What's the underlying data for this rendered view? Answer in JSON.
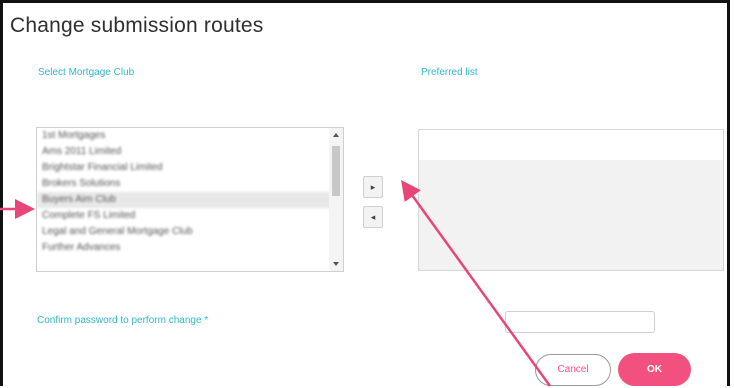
{
  "dialog": {
    "title": "Change submission routes",
    "select_label": "Select Mortgage Club",
    "preferred_label": "Preferred list",
    "confirm_label": "Confirm password to perform change *",
    "cancel_label": "Cancel",
    "ok_label": "OK",
    "move_right_label": "▸",
    "move_left_label": "◂"
  },
  "mortgage_clubs": [
    "1st Mortgages",
    "Ams 2011 Limited",
    "Brightstar Financial Limited",
    "Brokers Solutions",
    "Buyers Aim Club",
    "Complete FS Limited",
    "Legal and General Mortgage Club",
    "Further Advances"
  ],
  "selected_index": 4,
  "annotation_color": "#e8457a"
}
